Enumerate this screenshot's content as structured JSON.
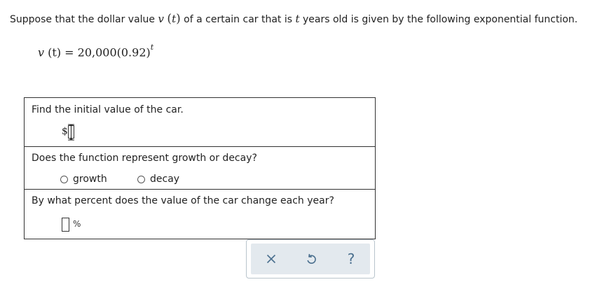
{
  "prompt": {
    "prefix": "Suppose that the dollar value ",
    "var_v": "v",
    "paren_open": "(",
    "var_t": "t",
    "paren_close": ")",
    "middle": " of a certain car that is ",
    "var_t2": "t",
    "suffix": " years old is given by the following exponential function."
  },
  "formula": {
    "lhs_v": "v",
    "lhs_t": "(t)",
    "rhs": " = 20,000(0.92)",
    "exponent": "t"
  },
  "questions": {
    "q1": {
      "text": "Find the initial value of the car.",
      "currency": "$",
      "value": ""
    },
    "q2": {
      "text": "Does the function represent growth or decay?",
      "options": [
        "growth",
        "decay"
      ],
      "selected": null
    },
    "q3": {
      "text": "By what percent does the value of the car change each year?",
      "unit": "%",
      "value": ""
    }
  },
  "toolbar": {
    "clear_icon": "x-icon",
    "undo_icon": "undo-icon",
    "help_label": "?"
  },
  "colors": {
    "toolbar_bg": "#e3e9ee",
    "toolbar_border": "#b9c4cc",
    "icon_color": "#4a6f8e"
  }
}
